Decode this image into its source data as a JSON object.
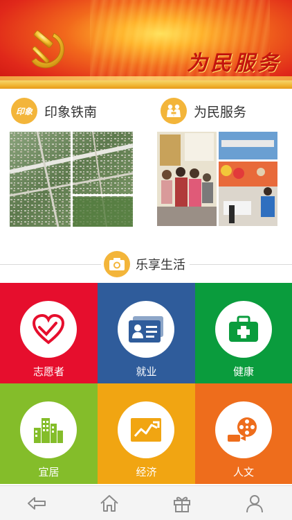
{
  "banner": {
    "title": "为民服务",
    "emblem_icon": "hammer-sickle-emblem"
  },
  "sections": [
    {
      "label": "印象铁南",
      "badge_text": "印象",
      "icon": "yinxiang-badge-icon"
    },
    {
      "label": "为民服务",
      "icon": "service-people-icon"
    }
  ],
  "life": {
    "title": "乐享生活",
    "icon": "camera-icon"
  },
  "tiles": [
    {
      "label": "志愿者",
      "color": "#e60e2d",
      "icon": "heart-hand-icon"
    },
    {
      "label": "就业",
      "color": "#2f5c9b",
      "icon": "id-card-icon"
    },
    {
      "label": "健康",
      "color": "#0a9c3d",
      "icon": "medical-kit-icon"
    },
    {
      "label": "宜居",
      "color": "#84bd2a",
      "icon": "buildings-icon"
    },
    {
      "label": "经济",
      "color": "#f1a512",
      "icon": "chart-trend-icon"
    },
    {
      "label": "人文",
      "color": "#ee6d1c",
      "icon": "film-reel-icon"
    }
  ],
  "nav": [
    {
      "name": "back",
      "icon": "back-arrow-icon"
    },
    {
      "name": "home",
      "icon": "home-icon"
    },
    {
      "name": "gift",
      "icon": "gift-icon"
    },
    {
      "name": "profile",
      "icon": "user-icon"
    }
  ],
  "colors": {
    "accent_gold": "#f3b53a",
    "banner_red": "#c3150e"
  }
}
